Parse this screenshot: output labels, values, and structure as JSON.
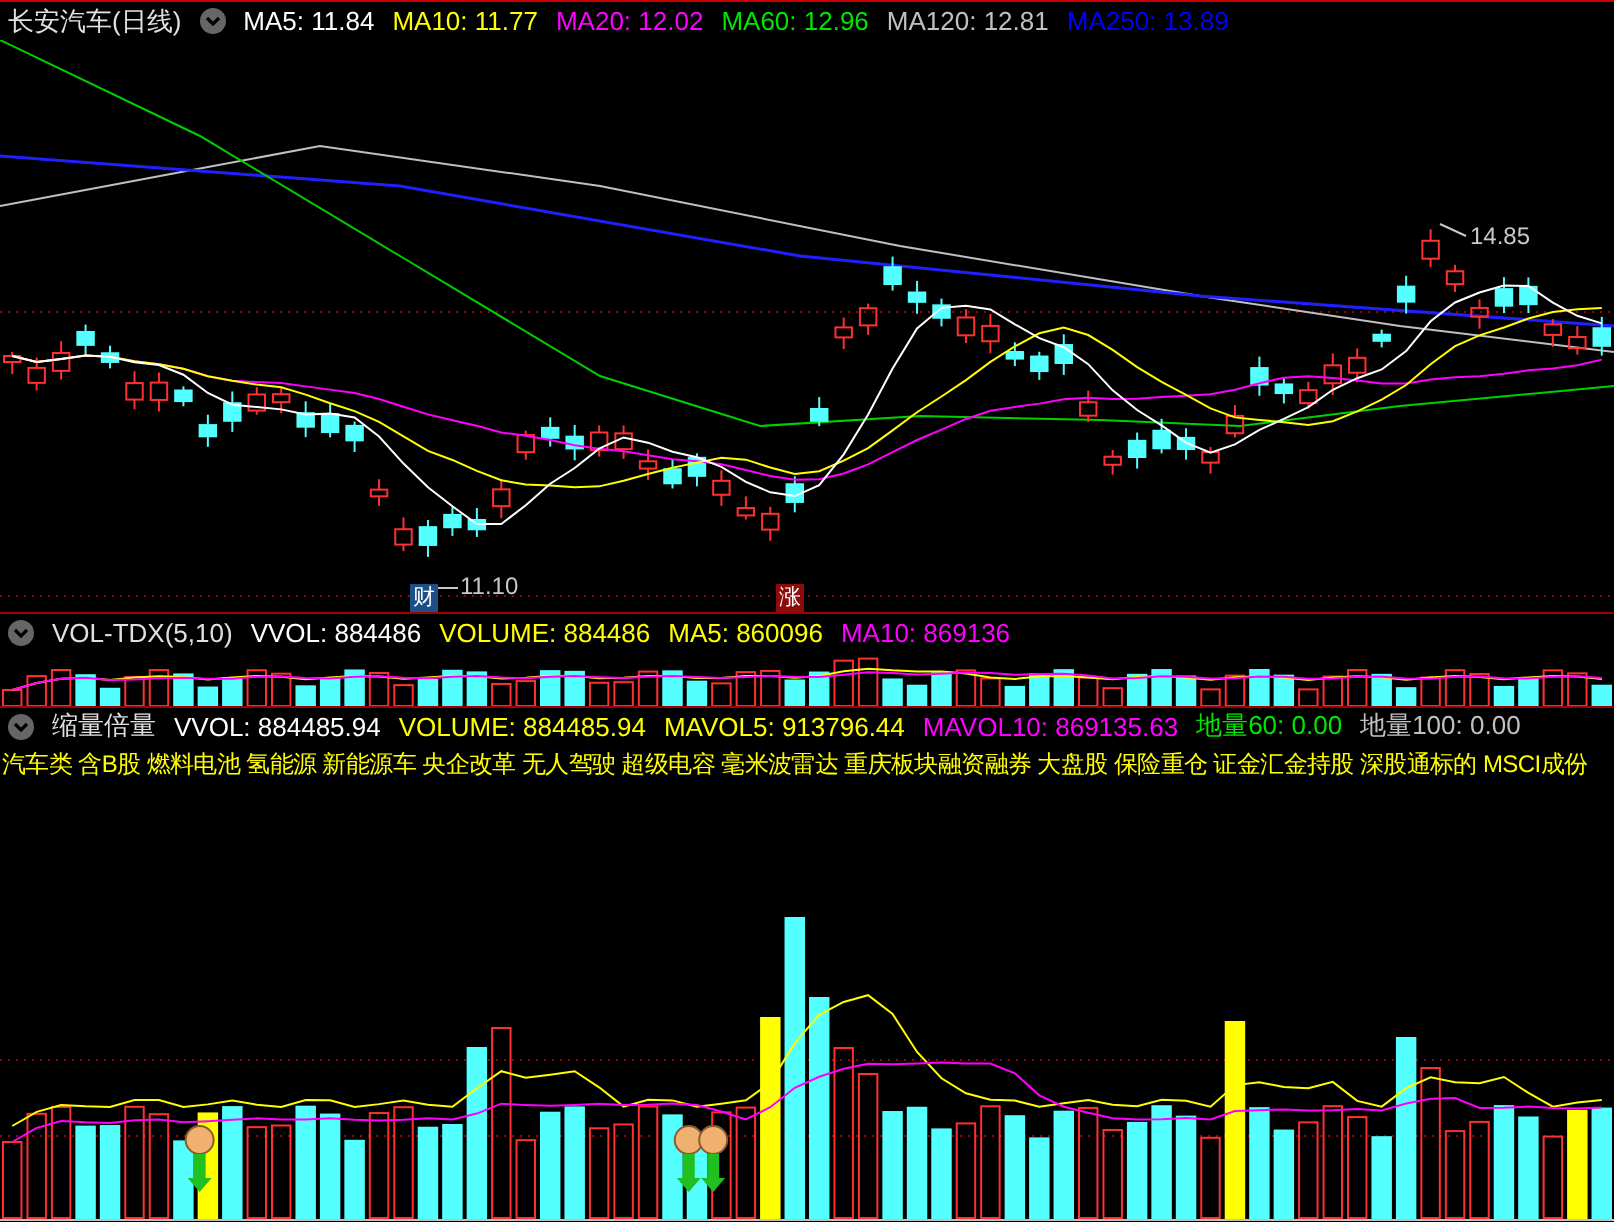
{
  "title": "长安汽车(日线)",
  "main_indicators": [
    {
      "label": "MA5: 11.84",
      "color": "#ffffff"
    },
    {
      "label": "MA10: 11.77",
      "color": "#ffff00"
    },
    {
      "label": "MA20: 12.02",
      "color": "#ff00ff"
    },
    {
      "label": "MA60: 12.96",
      "color": "#00e600"
    },
    {
      "label": "MA120: 12.81",
      "color": "#c0c0c0"
    },
    {
      "label": "MA250: 13.89",
      "color": "#0000ff"
    }
  ],
  "price_labels": [
    {
      "kind": "high",
      "text": "14.85"
    },
    {
      "kind": "low",
      "text": "11.10"
    }
  ],
  "markers": [
    {
      "text": "财",
      "color": "#1c4f86"
    },
    {
      "text": "涨",
      "color": "#8c0b0b"
    }
  ],
  "volume_panel": {
    "name": "VOL-TDX(5,10)",
    "indicators": [
      {
        "label": "VVOL: 884486",
        "color": "#ffffff"
      },
      {
        "label": "VOLUME: 884486",
        "color": "#ffff00"
      },
      {
        "label": "MA5: 860096",
        "color": "#ffff00"
      },
      {
        "label": "MA10: 869136",
        "color": "#ff00ff"
      }
    ]
  },
  "lower_panel": {
    "name": "缩量倍量",
    "indicators": [
      {
        "label": "VVOL: 884485.94",
        "color": "#ffffff"
      },
      {
        "label": "VOLUME: 884485.94",
        "color": "#ffff00"
      },
      {
        "label": "MAVOL5: 913796.44",
        "color": "#ffff00"
      },
      {
        "label": "MAVOL10: 869135.63",
        "color": "#ff00ff"
      },
      {
        "label": "地量60: 0.00",
        "color": "#00e600"
      },
      {
        "label": "地量100: 0.00",
        "color": "#c0c0c0"
      }
    ],
    "sectors": "汽车类 含B股 燃料电池 氢能源 新能源车 央企改革 无人驾驶 超级电容 毫米波雷达 重庆板块融资融券 大盘股 保险重仓 证金汇金持股 深股通标的 MSCI成份"
  }
}
